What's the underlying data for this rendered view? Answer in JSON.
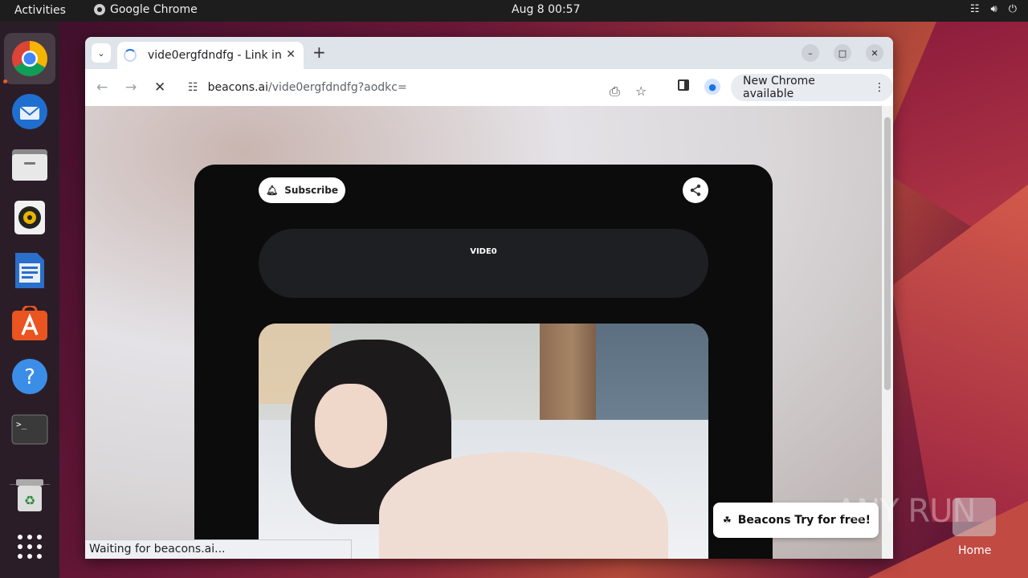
{
  "topbar": {
    "activities": "Activities",
    "app_name": "Google Chrome",
    "clock": "Aug 8  00:57"
  },
  "dock": {
    "items": [
      "chrome-icon",
      "thunderbird-icon",
      "files-icon",
      "rhythmbox-icon",
      "writer-icon",
      "app-center-icon",
      "help-icon",
      "terminal-icon",
      "trash-icon",
      "app-grid-icon"
    ]
  },
  "browser": {
    "tab_title": "vide0ergfdndfg - Link in",
    "url_host": "beacons.ai",
    "url_path": "/vide0ergfdndfg?aodkc=",
    "new_chrome": "New Chrome available",
    "status": "Waiting for beacons.ai..."
  },
  "page": {
    "subscribe": "Subscribe",
    "video_link": "VIDE0",
    "beacons_name": "Beacons",
    "try_free": "Try for free!"
  },
  "desktop": {
    "home_label": "Home",
    "watermark": "ANY RUN"
  },
  "colors": {
    "accent_orange": "#e95420",
    "chrome_blue": "#1a73e8",
    "page_card": "#0c0c0c"
  }
}
